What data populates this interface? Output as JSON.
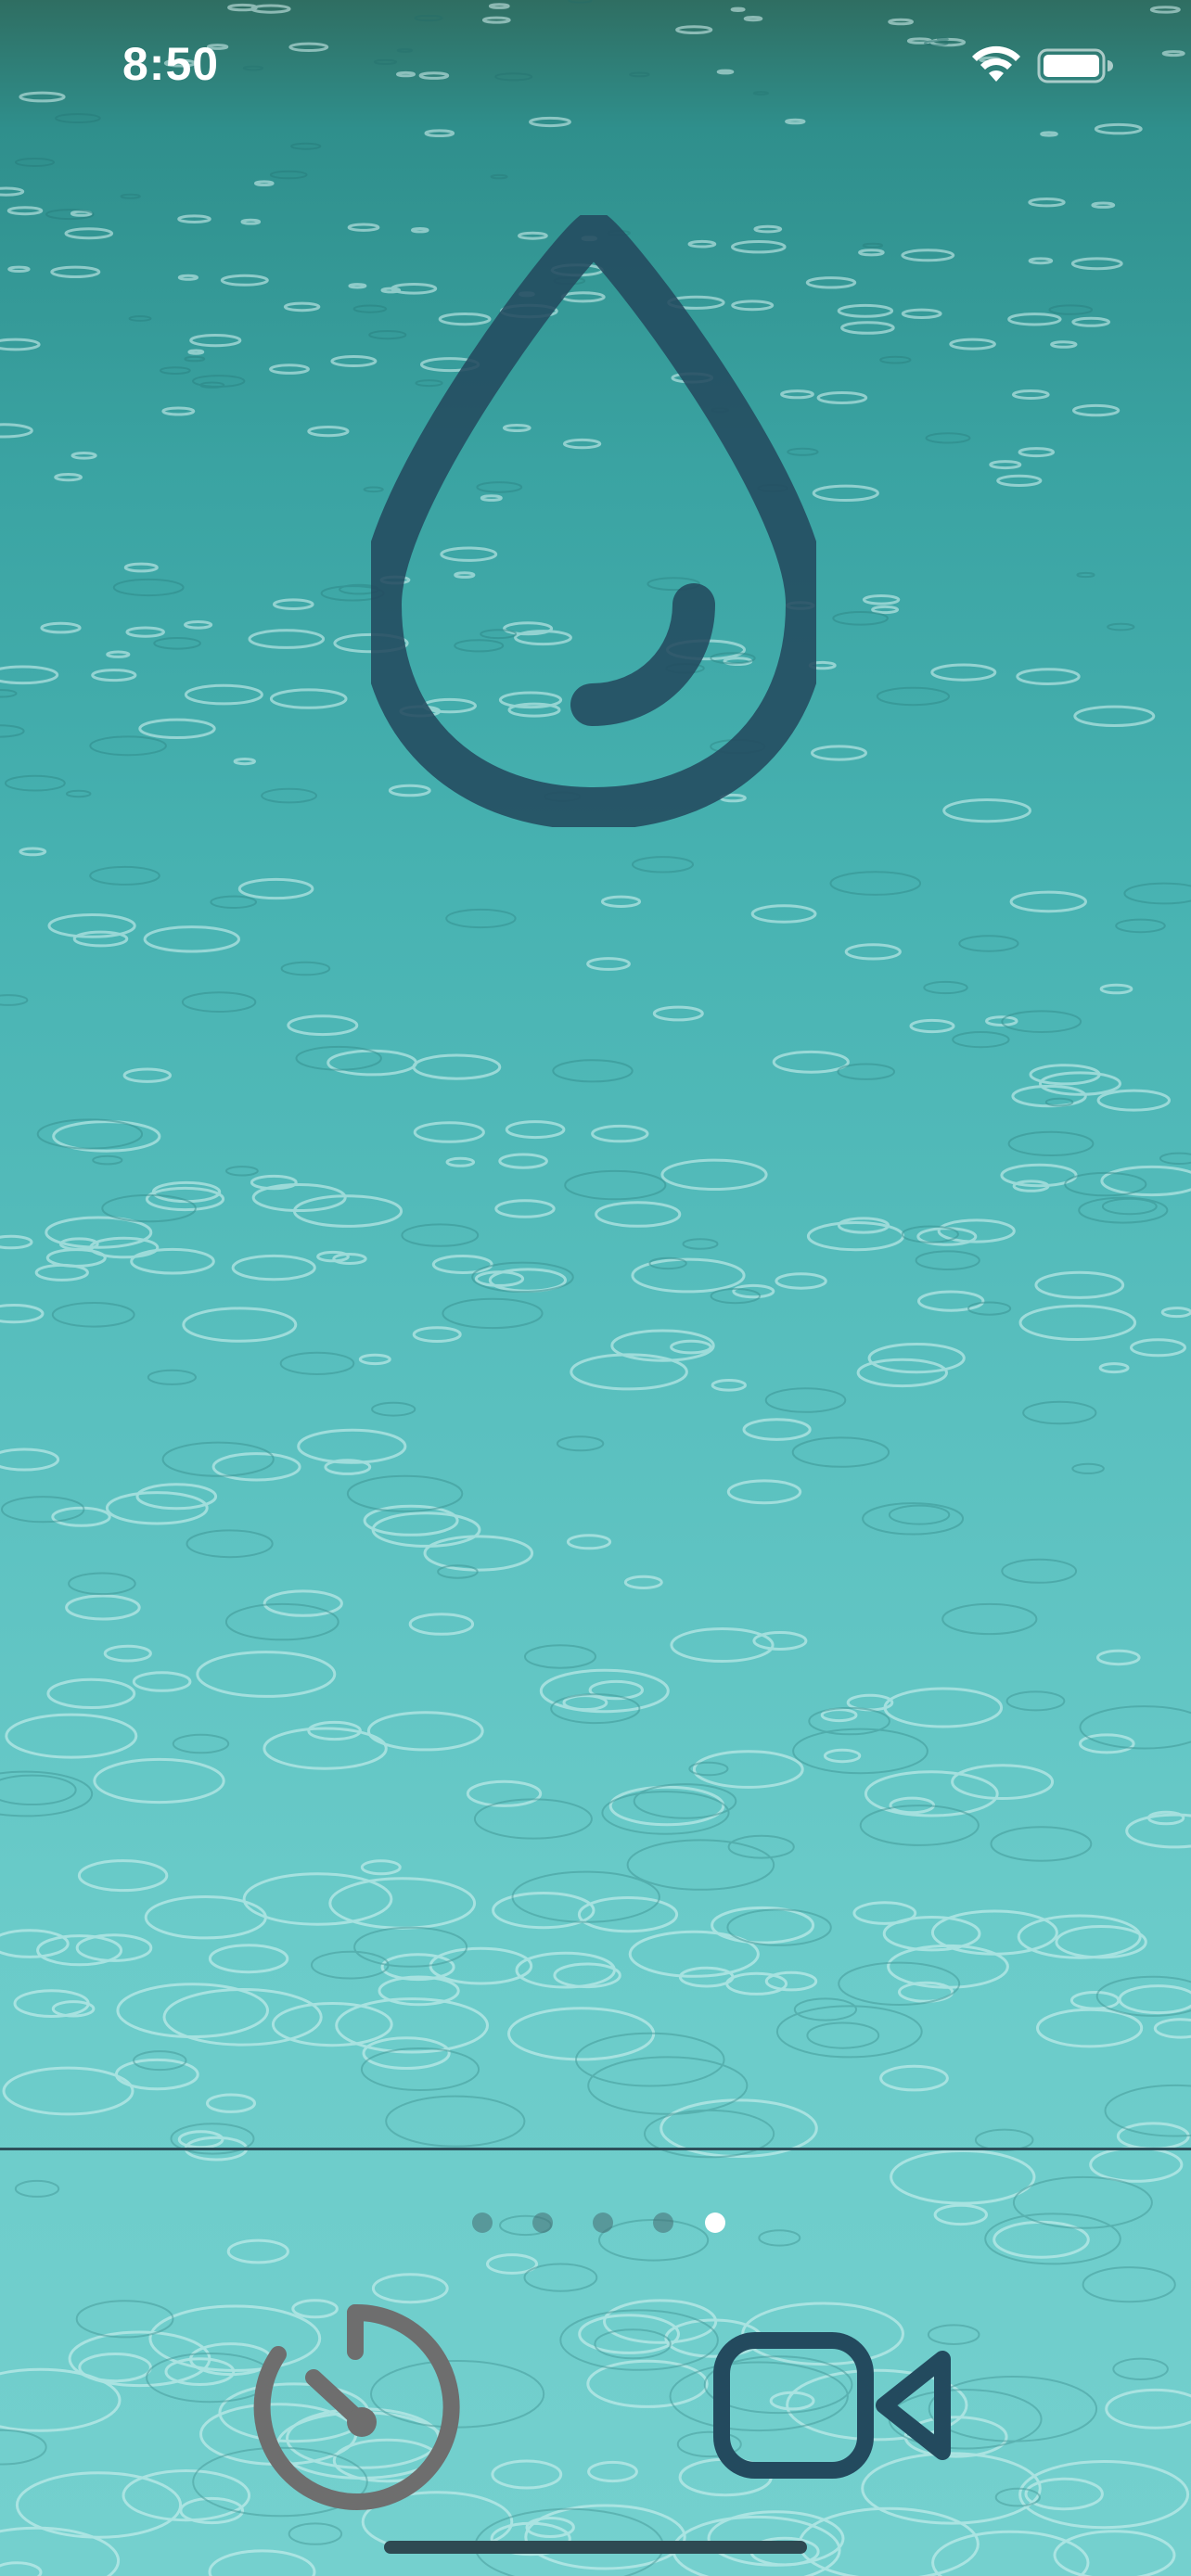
{
  "status_bar": {
    "time": "8:50",
    "wifi_icon": "wifi-icon",
    "battery_icon": "battery-icon"
  },
  "main": {
    "icon": "water-drop-icon",
    "icon_color": "#234a5e"
  },
  "page_indicator": {
    "count": 5,
    "active_index": 4
  },
  "bottom_bar": {
    "timer_icon": "timer-icon",
    "timer_color": "#6e6e6e",
    "video_icon": "video-camera-icon",
    "video_color": "#234a5e"
  },
  "colors": {
    "background_top": "#2f6e62",
    "background_bottom": "#74d0ce",
    "divider": "#2d4f5a"
  }
}
